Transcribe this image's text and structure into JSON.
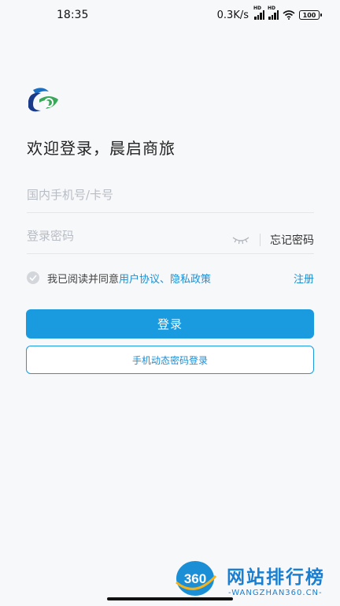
{
  "status_bar": {
    "time": "18:35",
    "net_speed": "0.3K/s",
    "signal_label": "HD",
    "battery": "100"
  },
  "login": {
    "welcome": "欢迎登录，晨启商旅",
    "phone_placeholder": "国内手机号/卡号",
    "password_placeholder": "登录密码",
    "forgot_password": "忘记密码",
    "agree_prefix": "我已阅读并同意",
    "user_agreement": "用户协议",
    "separator": "、",
    "privacy_policy": "隐私政策",
    "register": "注册",
    "login_button": "登录",
    "sms_login_button": "手机动态密码登录"
  },
  "watermark": {
    "logo_text": "360",
    "title": "网站排行榜",
    "subtitle": "-WANGZHAN360.CN-"
  },
  "colors": {
    "accent": "#1a9be0",
    "link": "#1a8fd6",
    "background": "#f7f8fa"
  }
}
